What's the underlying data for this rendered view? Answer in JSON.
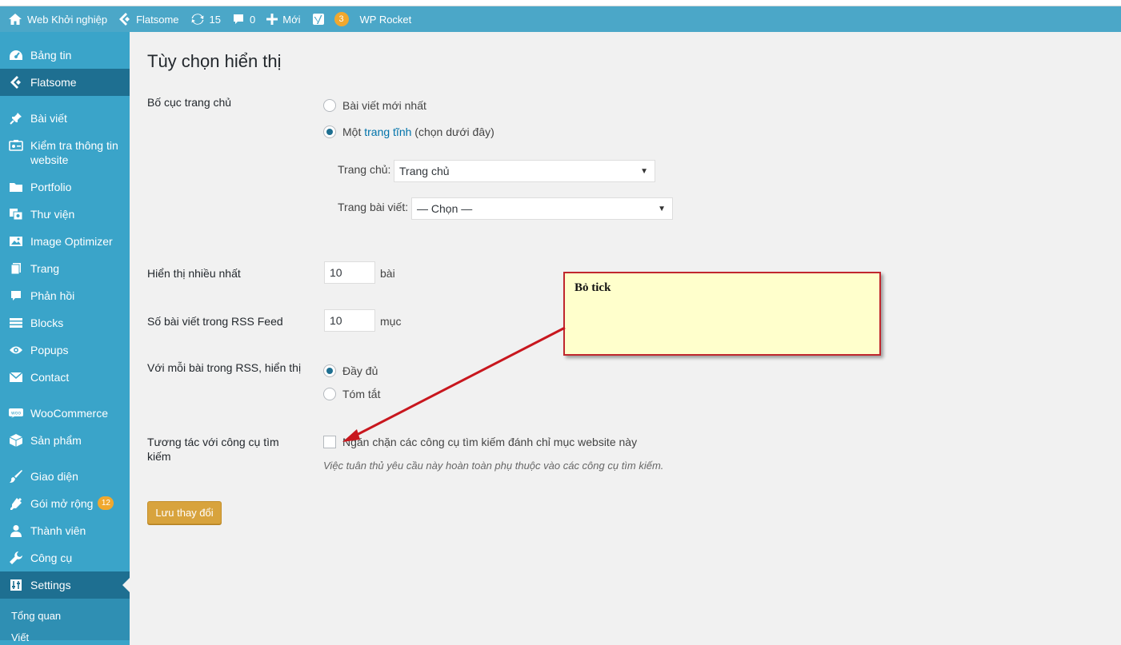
{
  "adminbar": {
    "site_name": "Web Khởi nghiệp",
    "theme": "Flatsome",
    "updates_count": "15",
    "comments_count": "0",
    "new_label": "Mới",
    "yoast_count": "3",
    "wp_rocket": "WP Rocket",
    "bar_color": "#4ba7c8"
  },
  "sidebar": {
    "items": [
      {
        "label": "Bảng tin",
        "icon": "dashboard-icon"
      },
      {
        "label": "Flatsome",
        "icon": "flatsome-icon"
      },
      {
        "label": "Bài viết",
        "icon": "pin-icon"
      },
      {
        "label": "Kiểm tra thông tin website",
        "icon": "id-card-icon"
      },
      {
        "label": "Portfolio",
        "icon": "folder-icon"
      },
      {
        "label": "Thư viện",
        "icon": "media-icon"
      },
      {
        "label": "Image Optimizer",
        "icon": "image-icon"
      },
      {
        "label": "Trang",
        "icon": "page-icon"
      },
      {
        "label": "Phản hồi",
        "icon": "comment-icon"
      },
      {
        "label": "Blocks",
        "icon": "blocks-icon"
      },
      {
        "label": "Popups",
        "icon": "eye-icon"
      },
      {
        "label": "Contact",
        "icon": "mail-icon"
      },
      {
        "label": "WooCommerce",
        "icon": "woo-icon"
      },
      {
        "label": "Sản phẩm",
        "icon": "box-icon"
      },
      {
        "label": "Giao diện",
        "icon": "brush-icon"
      },
      {
        "label": "Gói mở rộng",
        "icon": "plugin-icon",
        "badge": "12"
      },
      {
        "label": "Thành viên",
        "icon": "user-icon"
      },
      {
        "label": "Công cụ",
        "icon": "wrench-icon"
      },
      {
        "label": "Settings",
        "icon": "settings-icon"
      }
    ],
    "submenu": [
      "Tổng quan",
      "Viết"
    ],
    "color": "#3aa4c9"
  },
  "main": {
    "title": "Tùy chọn hiển thị",
    "homepage": {
      "label": "Bố cục trang chủ",
      "option_latest": "Bài viết mới nhất",
      "option_static_prefix": "Một ",
      "option_static_link": "trang tĩnh",
      "option_static_suffix": " (chọn dưới đây)",
      "homepage_label": "Trang chủ:",
      "homepage_value": "Trang chủ",
      "postspage_label": "Trang bài viết:",
      "postspage_value": "— Chọn —"
    },
    "posts_per_page": {
      "label": "Hiển thị nhiều nhất",
      "value": "10",
      "unit": "bài"
    },
    "rss_posts": {
      "label": "Số bài viết trong RSS Feed",
      "value": "10",
      "unit": "mục"
    },
    "rss_display": {
      "label": "Với mỗi bài trong RSS, hiển thị",
      "option_full": "Đầy đủ",
      "option_summary": "Tóm tắt"
    },
    "search_engine": {
      "label_line1": "Tương tác với công cụ tìm",
      "label_line2": "kiếm",
      "checkbox_label": "Ngăn chặn các công cụ tìm kiếm đánh chỉ mục website này",
      "description": "Việc tuân thủ yêu cầu này hoàn toàn phụ thuộc vào các công cụ tìm kiếm."
    },
    "save_label": "Lưu thay đổi"
  },
  "callout": {
    "text": "Bỏ tick",
    "border_color": "#c0272d",
    "fill_color": "#ffffcc"
  }
}
